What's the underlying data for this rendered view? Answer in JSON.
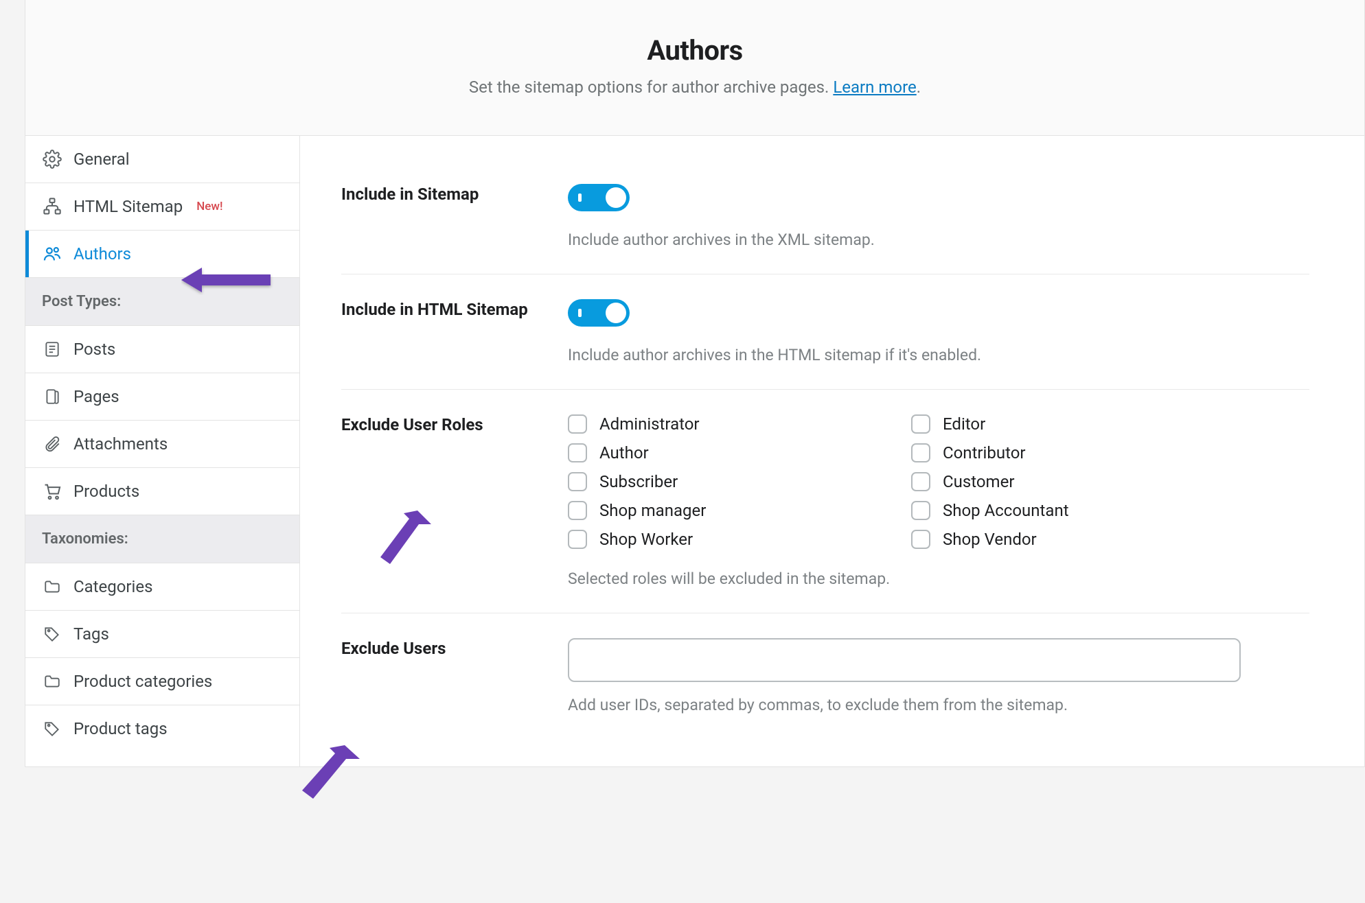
{
  "header": {
    "title": "Authors",
    "description_pre": "Set the sitemap options for author archive pages. ",
    "learn_more": "Learn more",
    "description_post": "."
  },
  "sidebar": {
    "items": [
      {
        "label": "General"
      },
      {
        "label": "HTML Sitemap",
        "badge": "New!"
      },
      {
        "label": "Authors",
        "active": true
      }
    ],
    "post_types_header": "Post Types:",
    "post_types": [
      {
        "label": "Posts"
      },
      {
        "label": "Pages"
      },
      {
        "label": "Attachments"
      },
      {
        "label": "Products"
      }
    ],
    "taxonomies_header": "Taxonomies:",
    "taxonomies": [
      {
        "label": "Categories"
      },
      {
        "label": "Tags"
      },
      {
        "label": "Product categories"
      },
      {
        "label": "Product tags"
      }
    ]
  },
  "settings": {
    "include_sitemap": {
      "label": "Include in Sitemap",
      "enabled": true,
      "description": "Include author archives in the XML sitemap."
    },
    "include_html_sitemap": {
      "label": "Include in HTML Sitemap",
      "enabled": true,
      "description": "Include author archives in the HTML sitemap if it's enabled."
    },
    "exclude_roles": {
      "label": "Exclude User Roles",
      "description": "Selected roles will be excluded in the sitemap.",
      "roles_left": [
        "Administrator",
        "Author",
        "Subscriber",
        "Shop manager",
        "Shop Worker"
      ],
      "roles_right": [
        "Editor",
        "Contributor",
        "Customer",
        "Shop Accountant",
        "Shop Vendor"
      ]
    },
    "exclude_users": {
      "label": "Exclude Users",
      "value": "",
      "description": "Add user IDs, separated by commas, to exclude them from the sitemap."
    }
  }
}
